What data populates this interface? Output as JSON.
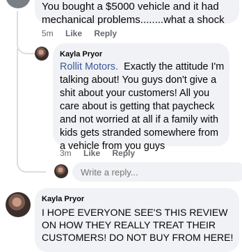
{
  "comment1": {
    "text_line1": "You bought a $5000 vehicle and it had",
    "text_line2": "mechanical problems........what a shock",
    "time": "5m",
    "like": "Like",
    "reply": "Reply"
  },
  "comment2": {
    "author": "Kayla Pryor",
    "mention": "Rollit Motors.",
    "text": "Exactly the attitude I'm talking about! You guys don't give a shit about your customers! All you care about is getting that paycheck and not worried at all if a family with kids gets stranded somewhere from a vehicle from you guys",
    "time": "3m",
    "like": "Like",
    "reply": "Reply"
  },
  "reply_box": {
    "placeholder": "Write a reply..."
  },
  "comment3": {
    "author": "Kayla Pryor",
    "text": "I HOPE EVERYONE SEE'S THIS REVIEW ON HOW THEY REALLY TREAT THEIR CUSTOMERS! DO NOT BUY FROM HERE!"
  }
}
